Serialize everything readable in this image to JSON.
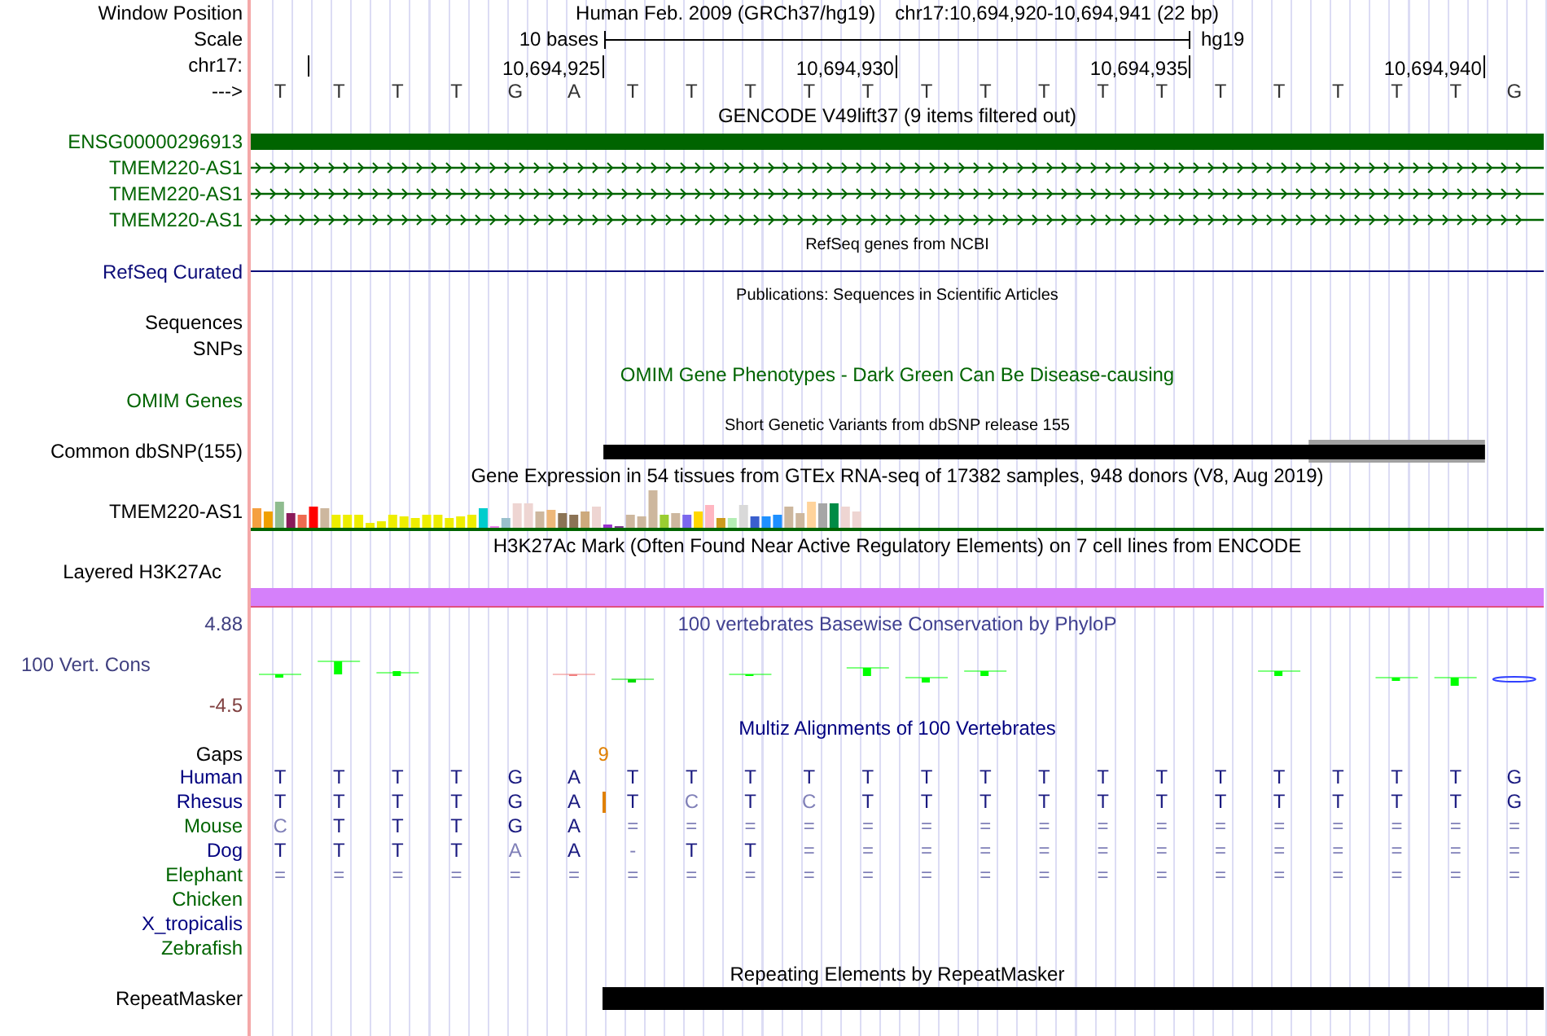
{
  "header": {
    "label": "Window Position",
    "assembly": "Human Feb. 2009 (GRCh37/hg19)",
    "position": "chr17:10,694,920-10,694,941 (22 bp)"
  },
  "scale": {
    "label": "Scale",
    "span": "10 bases",
    "assembly": "hg19"
  },
  "ruler": {
    "label": "chr17:",
    "ticks": [
      "10,694,925",
      "10,694,930",
      "10,694,935",
      "10,694,940"
    ]
  },
  "sequence": {
    "label": "--->",
    "bases": [
      "T",
      "T",
      "T",
      "T",
      "G",
      "A",
      "T",
      "T",
      "T",
      "T",
      "T",
      "T",
      "T",
      "T",
      "T",
      "T",
      "T",
      "T",
      "T",
      "T",
      "T",
      "G"
    ]
  },
  "tracks": [
    {
      "kind": "title",
      "text": "GENCODE V49lift37 (9 items filtered out)"
    },
    {
      "kind": "gene",
      "label": "ENSG00000296913",
      "color": "#006400"
    },
    {
      "kind": "transcript",
      "label": "TMEM220-AS1",
      "color": "#006400"
    },
    {
      "kind": "transcript",
      "label": "TMEM220-AS1",
      "color": "#006400"
    },
    {
      "kind": "transcript",
      "label": "TMEM220-AS1",
      "color": "#006400"
    },
    {
      "kind": "note",
      "text": "RefSeq genes from NCBI"
    },
    {
      "kind": "line",
      "label": "RefSeq Curated",
      "color": "#0c0c78"
    },
    {
      "kind": "note",
      "text": "Publications: Sequences in Scientific Articles"
    },
    {
      "kind": "label",
      "label": "Sequences"
    },
    {
      "kind": "label",
      "label": "SNPs"
    },
    {
      "kind": "title",
      "text": "OMIM Gene Phenotypes - Dark Green Can Be Disease-causing",
      "color": "#006400"
    },
    {
      "kind": "label",
      "label": "OMIM Genes",
      "color": "#006400"
    },
    {
      "kind": "note",
      "text": "Short Genetic Variants from dbSNP release 155"
    },
    {
      "kind": "snp",
      "label": "Common dbSNP(155)"
    },
    {
      "kind": "title",
      "text": "Gene Expression in 54 tissues from GTEx RNA-seq of 17382 samples, 948 donors (V8, Aug 2019)"
    },
    {
      "kind": "expression",
      "label": "TMEM220-AS1"
    },
    {
      "kind": "title",
      "text": "H3K27Ac Mark (Often Found Near Active Regulatory Elements) on 7 cell lines from ENCODE"
    },
    {
      "kind": "layered",
      "label": "Layered H3K27Ac"
    },
    {
      "kind": "conservation",
      "label": "100 Vert. Cons",
      "max": "4.88",
      "min": "-4.5",
      "title": "100 vertebrates Basewise Conservation by PhyloP"
    },
    {
      "kind": "title",
      "text": "Multiz Alignments of 100 Vertebrates",
      "color": "#000080"
    },
    {
      "kind": "gaps",
      "label": "Gaps",
      "count": "9"
    },
    {
      "kind": "species",
      "label": "Human",
      "color": "#000080",
      "insertion": false,
      "bases": [
        "T",
        "T",
        "T",
        "T",
        "G",
        "A",
        "T",
        "T",
        "T",
        "T",
        "T",
        "T",
        "T",
        "T",
        "T",
        "T",
        "T",
        "T",
        "T",
        "T",
        "T",
        "G"
      ]
    },
    {
      "kind": "species",
      "label": "Rhesus",
      "color": "#000080",
      "insertion": true,
      "bases": [
        "T",
        "T",
        "T",
        "T",
        "G",
        "A",
        "T",
        "C",
        "T",
        "C",
        "T",
        "T",
        "T",
        "T",
        "T",
        "T",
        "T",
        "T",
        "T",
        "T",
        "T",
        "G"
      ]
    },
    {
      "kind": "species",
      "label": "Mouse",
      "color": "#006400",
      "insertion": false,
      "bases": [
        "C",
        "T",
        "T",
        "T",
        "G",
        "A",
        "=",
        "=",
        "=",
        "=",
        "=",
        "=",
        "=",
        "=",
        "=",
        "=",
        "=",
        "=",
        "=",
        "=",
        "=",
        "="
      ]
    },
    {
      "kind": "species",
      "label": "Dog",
      "color": "#000080",
      "insertion": false,
      "bases": [
        "T",
        "T",
        "T",
        "T",
        "A",
        "A",
        "-",
        "T",
        "T",
        "=",
        "=",
        "=",
        "=",
        "=",
        "=",
        "=",
        "=",
        "=",
        "=",
        "=",
        "=",
        "="
      ]
    },
    {
      "kind": "species",
      "label": "Elephant",
      "color": "#006400",
      "insertion": false,
      "bases": [
        "=",
        "=",
        "=",
        "=",
        "=",
        "=",
        "=",
        "=",
        "=",
        "=",
        "=",
        "=",
        "=",
        "=",
        "=",
        "=",
        "=",
        "=",
        "=",
        "=",
        "=",
        "="
      ]
    },
    {
      "kind": "species",
      "label": "Chicken",
      "color": "#006400",
      "insertion": false
    },
    {
      "kind": "species",
      "label": "X_tropicalis",
      "color": "#000080",
      "insertion": false
    },
    {
      "kind": "species",
      "label": "Zebrafish",
      "color": "#006400",
      "insertion": false
    },
    {
      "kind": "title",
      "text": "Repeating Elements by RepeatMasker"
    },
    {
      "kind": "repeat",
      "label": "RepeatMasker"
    }
  ]
}
